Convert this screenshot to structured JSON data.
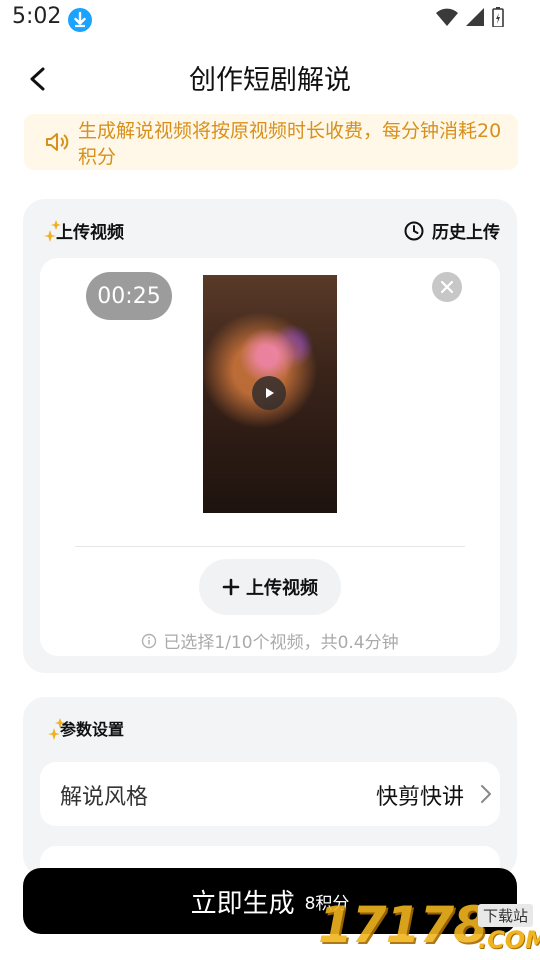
{
  "status_bar": {
    "time": "5:02"
  },
  "header": {
    "title": "创作短剧解说"
  },
  "notice": {
    "text": "生成解说视频将按原视频时长收费，每分钟消耗20积分"
  },
  "upload": {
    "section_title": "上传视频",
    "history_label": "历史上传",
    "video": {
      "duration": "00:25"
    },
    "upload_button_label": "上传视频",
    "selection_note": "已选择1/10个视频，共0.4分钟"
  },
  "params": {
    "section_title": "参数设置",
    "rows": [
      {
        "label": "解说风格",
        "value": "快剪快讲"
      }
    ]
  },
  "generate": {
    "label": "立即生成",
    "cost": "8积分"
  },
  "watermark": {
    "number": "17178",
    "tag": "下载站",
    "domain": ".COM"
  },
  "colors": {
    "accent_orange": "#d8901c",
    "notice_bg": "#fff8e8",
    "card_bg": "#f3f4f6",
    "primary_btn": "#000000"
  },
  "icons": [
    "download-notification-icon",
    "wifi-icon",
    "signal-icon",
    "battery-icon",
    "back-arrow-icon",
    "speaker-icon",
    "sparkle-icon",
    "clock-icon",
    "play-icon",
    "close-icon",
    "plus-icon",
    "info-icon",
    "chevron-right-icon"
  ]
}
